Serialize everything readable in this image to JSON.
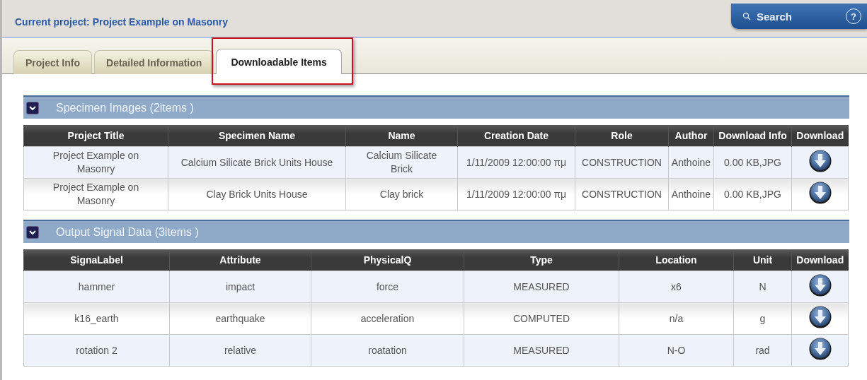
{
  "header": {
    "current_project": "Current project: Project Example on Masonry",
    "search_button": "Search",
    "help_button": "?"
  },
  "tabs": [
    {
      "label": "Project Info",
      "selected": false
    },
    {
      "label": "Detailed Information",
      "selected": false
    },
    {
      "label": "Downloadable Items",
      "selected": true
    }
  ],
  "sections": [
    {
      "title": "Specimen Images (2items )",
      "expanded": true,
      "columns": [
        "Project Title",
        "Specimen Name",
        "Name",
        "Creation Date",
        "Role",
        "Author",
        "Download Info",
        "Download"
      ],
      "rows": [
        [
          "Project Example on Masonry",
          "Calcium Silicate Brick Units House",
          "Calcium Silicate Brick",
          "1/11/2009 12:00:00 πμ",
          "CONSTRUCTION",
          "Anthoine",
          "0.00 KB,JPG"
        ],
        [
          "Project Example on Masonry",
          "Clay Brick Units House",
          "Clay brick",
          "1/11/2009 12:00:00 πμ",
          "CONSTRUCTION",
          "Anthoine",
          "0.00 KB,JPG"
        ]
      ]
    },
    {
      "title": "Output Signal Data (3items )",
      "expanded": true,
      "columns": [
        "SignaLabel",
        "Attribute",
        "PhysicalQ",
        "Type",
        "Location",
        "Unit",
        "Download"
      ],
      "rows": [
        [
          "hammer",
          "impact",
          "force",
          "MEASURED",
          "x6",
          "N"
        ],
        [
          "k16_earth",
          "earthquake",
          "acceleration",
          "COMPUTED",
          "n/a",
          "g"
        ],
        [
          "rotation 2",
          "relative",
          "roatation",
          "MEASURED",
          "N-O",
          "rad"
        ]
      ]
    }
  ]
}
